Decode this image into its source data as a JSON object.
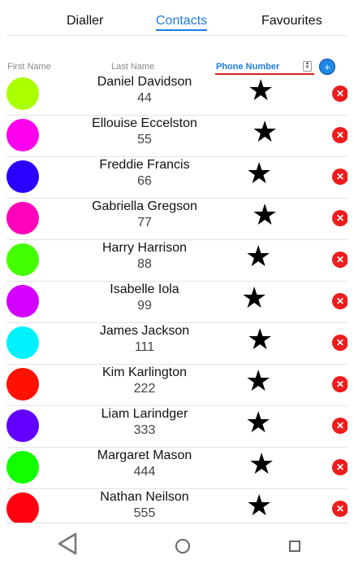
{
  "tabs": [
    {
      "label": "Dialler"
    },
    {
      "label": "Contacts"
    },
    {
      "label": "Favourites"
    }
  ],
  "columns": {
    "first_name": "First Name",
    "last_name": "Last Name",
    "sort_selected": "Phone Number"
  },
  "add_button": "+",
  "contacts": [
    {
      "name": "Daniel Davidson",
      "phone": "44",
      "color": "#aaff00"
    },
    {
      "name": "Ellouise Eccelston",
      "phone": "55",
      "color": "#ff00ee"
    },
    {
      "name": "Freddie Francis",
      "phone": "66",
      "color": "#2a00ff"
    },
    {
      "name": "Gabriella Gregson",
      "phone": "77",
      "color": "#ff00bb"
    },
    {
      "name": "Harry Harrison",
      "phone": "88",
      "color": "#44ff00"
    },
    {
      "name": "Isabelle Iola",
      "phone": "99",
      "color": "#d400ff"
    },
    {
      "name": "James Jackson",
      "phone": "111",
      "color": "#00f2ff"
    },
    {
      "name": "Kim Karlington",
      "phone": "222",
      "color": "#ff1100"
    },
    {
      "name": "Liam Larindger",
      "phone": "333",
      "color": "#6200ff"
    },
    {
      "name": "Margaret Mason",
      "phone": "444",
      "color": "#11ff00"
    },
    {
      "name": "Nathan Neilson",
      "phone": "555",
      "color": "#ff0010"
    }
  ],
  "favourite_icon": "star-icon",
  "delete_icon": "close-icon",
  "nav_icons": [
    "back-icon",
    "home-icon",
    "recents-icon"
  ]
}
